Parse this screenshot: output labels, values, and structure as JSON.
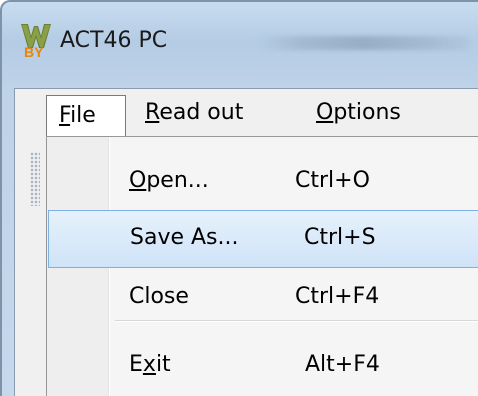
{
  "window": {
    "title": "ACT46 PC",
    "logo_icon": "wby-logo-icon"
  },
  "menubar": {
    "items": [
      {
        "label_ul": "F",
        "label_rest": "ile",
        "open": true
      },
      {
        "label_ul": "R",
        "label_rest": "ead out"
      },
      {
        "label_ul": "O",
        "label_rest": "ptions"
      }
    ]
  },
  "file_menu": {
    "items": [
      {
        "label_ul": "O",
        "label_rest": "pen...",
        "shortcut": "Ctrl+O"
      },
      {
        "label": "Save As...",
        "shortcut": "Ctrl+S",
        "highlighted": true
      },
      {
        "label": "Close",
        "shortcut": "Ctrl+F4"
      },
      {
        "label_pre": "E",
        "label_ul": "x",
        "label_rest": "it",
        "shortcut": "Alt+F4"
      }
    ]
  },
  "colors": {
    "highlight_border": "#7fb0e3",
    "highlight_fill": "#cfe3f8",
    "menu_bg": "#f0f0f0",
    "title_bar": "#b4cce4"
  }
}
